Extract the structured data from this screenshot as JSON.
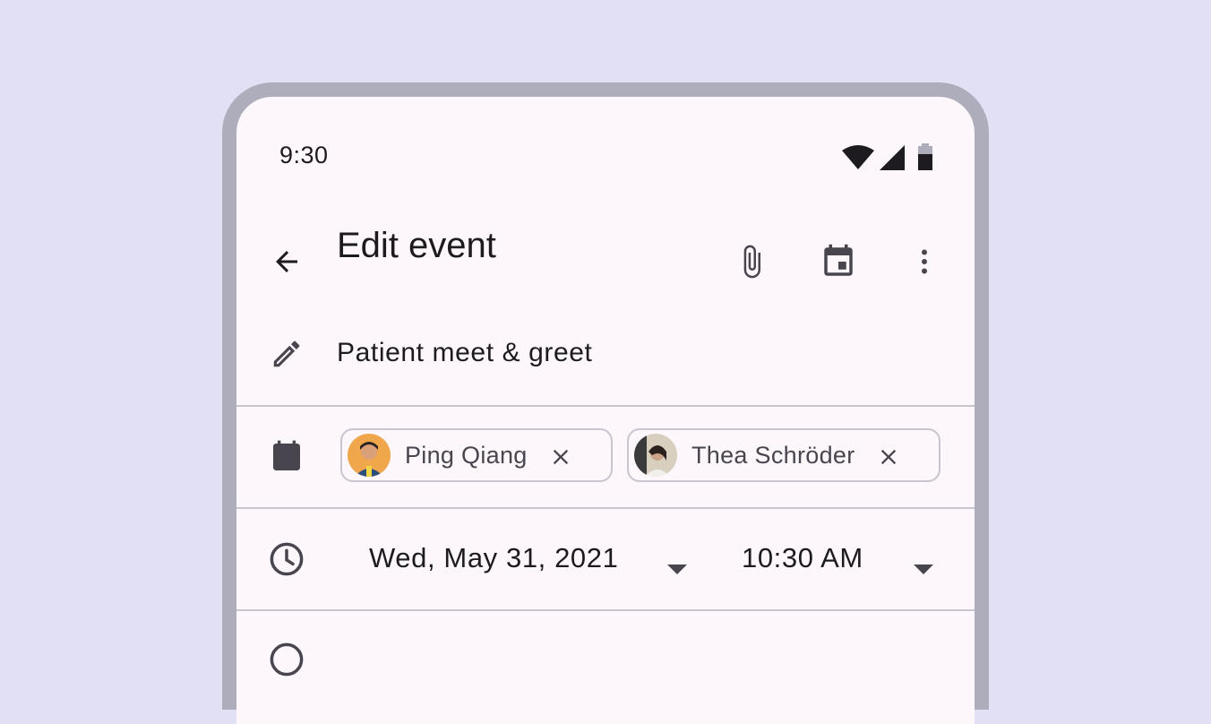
{
  "status_bar": {
    "time": "9:30",
    "icons": [
      "wifi-icon",
      "cellular-signal-icon",
      "battery-icon"
    ]
  },
  "top_app_bar": {
    "title": "Edit event",
    "navigation_icon": "arrow-back-icon",
    "actions": [
      "attachment-icon",
      "calendar-event-icon",
      "more-vert-icon"
    ]
  },
  "event": {
    "title": "Patient meet & greet",
    "title_icon": "pencil-icon"
  },
  "attendees": {
    "icon": "contact-badge-icon",
    "chips": [
      {
        "name": "Ping Qiang",
        "avatar": "avatar-ping-qiang",
        "remove_icon": "close-icon"
      },
      {
        "name": "Thea Schröder",
        "avatar": "avatar-thea-schroder",
        "remove_icon": "close-icon"
      }
    ]
  },
  "schedule": {
    "icon": "clock-icon",
    "date": "Wed, May 31, 2021",
    "time": "10:30 AM"
  },
  "colors": {
    "background": "#e1e0f5",
    "device_frame": "#aeadbc",
    "surface": "#fdf7fc",
    "on_surface": "#1d1b20",
    "on_surface_variant": "#49454f",
    "outline": "#cac4cf"
  }
}
